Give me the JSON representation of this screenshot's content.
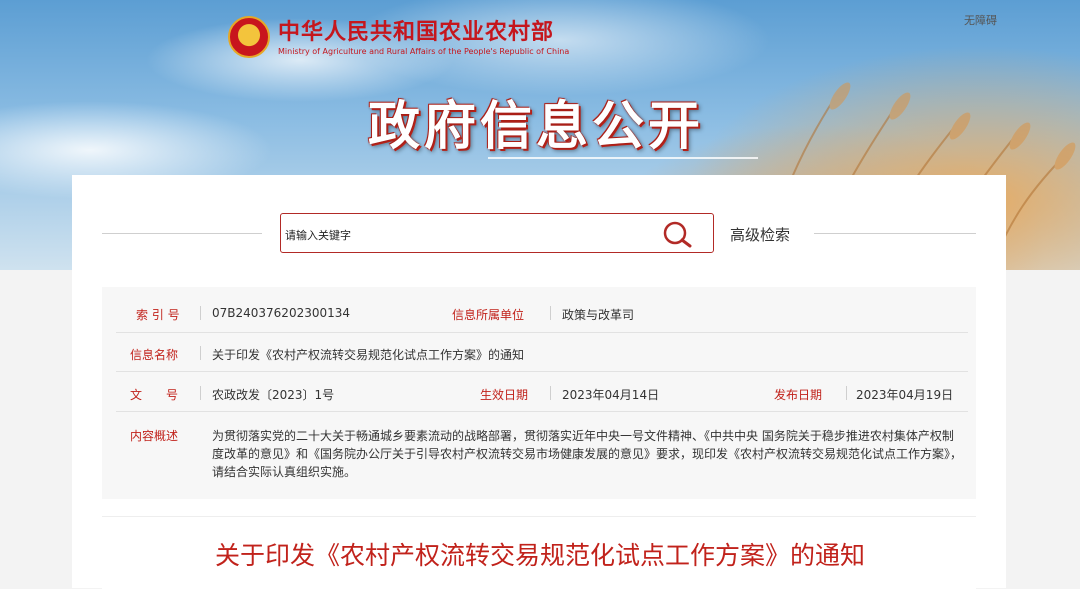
{
  "header": {
    "ministry_cn": "中华人民共和国农业农村部",
    "ministry_en": "Ministry of Agriculture and Rural Affairs of the People's Republic of China",
    "banner_title": "政府信息公开",
    "accessibility": "无障碍"
  },
  "search": {
    "placeholder": "请输入关键字",
    "advanced": "高级检索",
    "icon": "search-icon"
  },
  "info": {
    "index_label": "索 引 号",
    "index_value": "07B240376202300134",
    "unit_label": "信息所属单位",
    "unit_value": "政策与改革司",
    "name_label": "信息名称",
    "name_value": "关于印发《农村产权流转交易规范化试点工作方案》的通知",
    "doc_label": "文　　号",
    "doc_value": "农政改发〔2023〕1号",
    "effective_label": "生效日期",
    "effective_value": "2023年04月14日",
    "publish_label": "发布日期",
    "publish_value": "2023年04月19日",
    "summary_label": "内容概述",
    "summary_value": "为贯彻落实党的二十大关于畅通城乡要素流动的战略部署，贯彻落实近年中央一号文件精神、《中共中央 国务院关于稳步推进农村集体产权制度改革的意见》和《国务院办公厅关于引导农村产权流转交易市场健康发展的意见》要求，现印发《农村产权流转交易规范化试点工作方案》，请结合实际认真组织实施。"
  },
  "notice": {
    "title": "关于印发《农村产权流转交易规范化试点工作方案》的通知"
  },
  "colors": {
    "accent_red": "#c1221b",
    "search_border": "#b22a26"
  }
}
